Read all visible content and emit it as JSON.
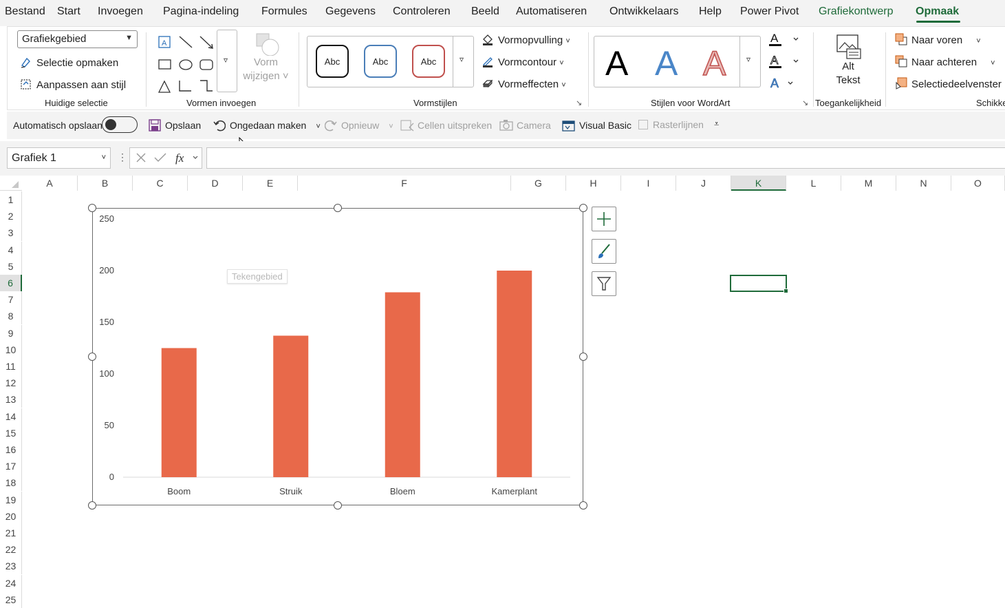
{
  "menu": {
    "tabs": [
      "Bestand",
      "Start",
      "Invoegen",
      "Pagina-indeling",
      "Formules",
      "Gegevens",
      "Controleren",
      "Beeld",
      "Automatiseren",
      "Ontwikkelaars",
      "Help",
      "Power Pivot",
      "Grafiekontwerp",
      "Opmaak"
    ],
    "active_tab": "Opmaak"
  },
  "ribbon": {
    "current_selection": {
      "dropdown_value": "Grafiekgebied",
      "format_selection": "Selectie opmaken",
      "reset_to_style": "Aanpassen aan stijl",
      "label": "Huidige selectie"
    },
    "insert_shapes": {
      "change_shape_line1": "Vorm",
      "change_shape_line2": "wijzigen",
      "label": "Vormen invoegen"
    },
    "shape_styles": {
      "preset_text": "Abc",
      "fill": "Vormopvulling",
      "outline": "Vormcontour",
      "effects": "Vormeffecten",
      "label": "Vormstijlen"
    },
    "wordart": {
      "glyph": "A",
      "label": "Stijlen voor WordArt"
    },
    "accessibility": {
      "alt_line1": "Alt",
      "alt_line2": "Tekst",
      "label": "Toegankelijkheid"
    },
    "arrange": {
      "bring_forward": "Naar voren",
      "send_backward": "Naar achteren",
      "selection_pane": "Selectiedeelvenster",
      "label": "Schikke"
    }
  },
  "qat": {
    "autosave": "Automatisch opslaan",
    "save": "Opslaan",
    "undo": "Ongedaan maken",
    "redo": "Opnieuw",
    "speak_cells": "Cellen uitspreken",
    "camera": "Camera",
    "visual_basic": "Visual Basic",
    "gridlines": "Rasterlijnen"
  },
  "formula_bar": {
    "name_box": "Grafiek 1",
    "fx": "fx",
    "formula": ""
  },
  "grid": {
    "columns": [
      "A",
      "B",
      "C",
      "D",
      "E",
      "F",
      "G",
      "H",
      "I",
      "J",
      "K",
      "L",
      "M",
      "N",
      "O"
    ],
    "rows": [
      "1",
      "2",
      "3",
      "4",
      "5",
      "6",
      "7",
      "8",
      "9",
      "10",
      "11",
      "12",
      "13",
      "14",
      "15",
      "16",
      "17",
      "18",
      "19",
      "20",
      "21",
      "22",
      "23",
      "24",
      "25"
    ],
    "selected_cell": "K6"
  },
  "chart_tooltip": "Tekengebied",
  "chart_data": {
    "type": "bar",
    "categories": [
      "Boom",
      "Struik",
      "Bloem",
      "Kamerplant"
    ],
    "values": [
      125,
      137,
      179,
      200
    ],
    "ylim": [
      0,
      250
    ],
    "yticks": [
      0,
      50,
      100,
      150,
      200,
      250
    ],
    "bar_color": "#E8694A",
    "grid": false
  },
  "colors": {
    "accent_green": "#1f6b3a",
    "bar": "#E8694A"
  }
}
